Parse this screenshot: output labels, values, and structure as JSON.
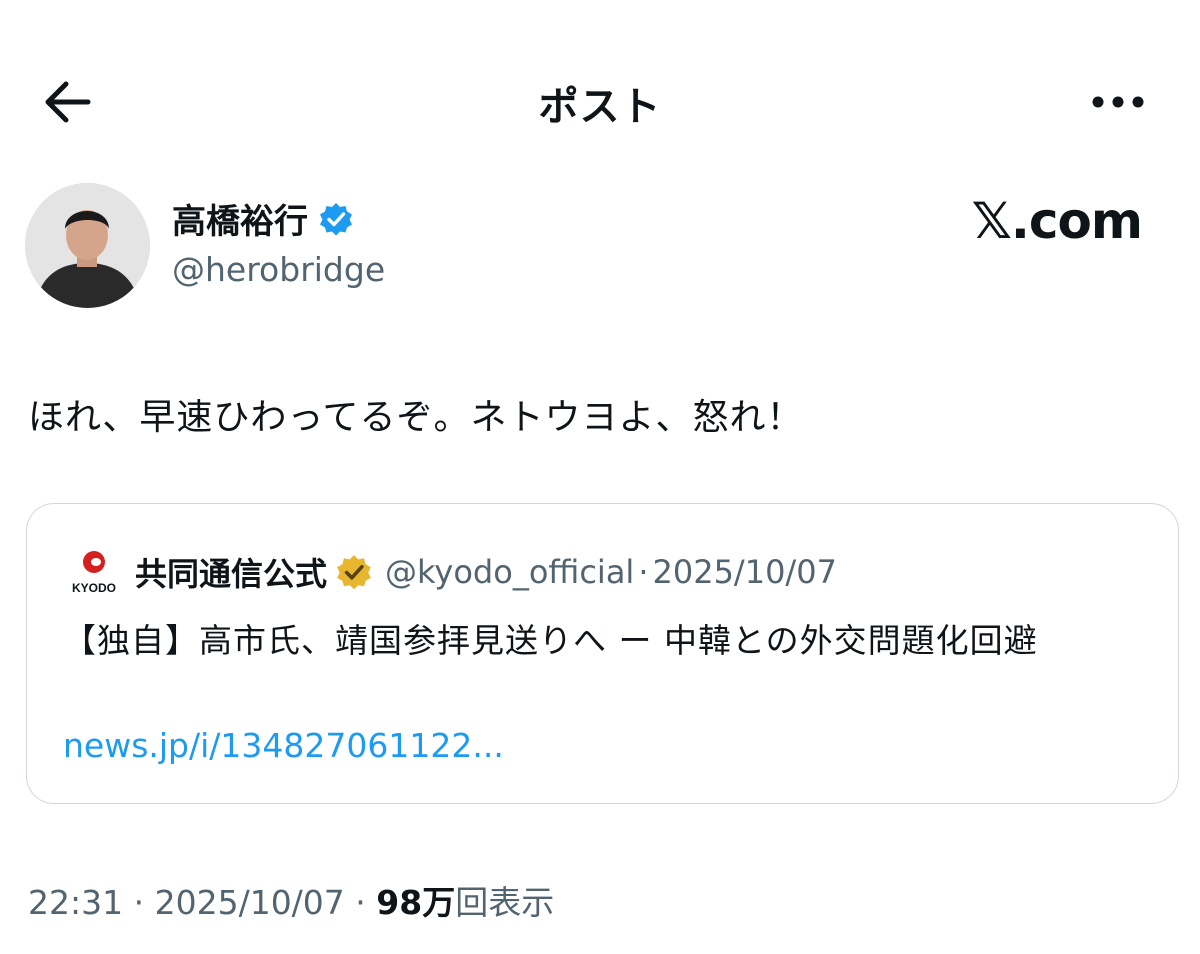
{
  "header": {
    "title": "ポスト",
    "back_icon": "back-arrow-icon",
    "more_icon": "more-dots-icon"
  },
  "post": {
    "author": {
      "name": "高橋裕行",
      "handle": "@herobridge",
      "verified_color": "#1d9bf0"
    },
    "brand": "𝕏.com",
    "text": "ほれ、早速ひわってるぞ。ネトウヨよ、怒れ！",
    "quoted": {
      "logo_text": "KYODO",
      "name": "共同通信公式",
      "badge_color": "#e8b730",
      "handle": "@kyodo_official",
      "dot": "·",
      "date": "2025/10/07",
      "text": "【独自】高市氏、靖国参拝見送りへ ー 中韓との外交問題化回避",
      "link": "news.jp/i/134827061122..."
    },
    "meta": {
      "time": "22:31",
      "sep1": " · ",
      "date": "2025/10/07",
      "sep2": " · ",
      "views": "98万",
      "views_label": "回表示"
    }
  },
  "colors": {
    "text": "#0f1419",
    "muted": "#536471",
    "link": "#1d9bf0",
    "border": "#d0d6dc"
  }
}
